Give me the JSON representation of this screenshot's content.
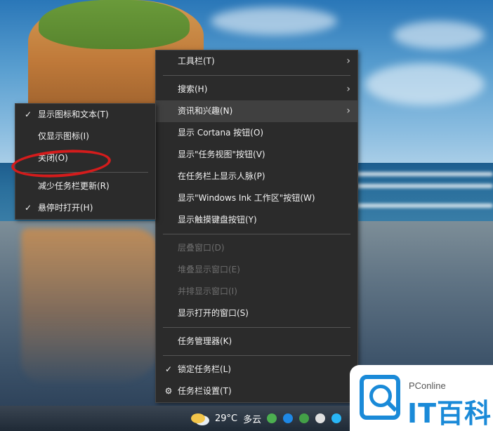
{
  "main_menu": {
    "items": [
      {
        "label": "工具栏(T)",
        "has_submenu": true
      },
      {
        "label": "搜索(H)",
        "has_submenu": true
      },
      {
        "label": "资讯和兴趣(N)",
        "has_submenu": true
      },
      {
        "label": "显示 Cortana 按钮(O)"
      },
      {
        "label": "显示\"任务视图\"按钮(V)"
      },
      {
        "label": "在任务栏上显示人脉(P)"
      },
      {
        "label": "显示\"Windows Ink 工作区\"按钮(W)"
      },
      {
        "label": "显示触摸键盘按钮(Y)"
      },
      {
        "label": "层叠窗口(D)",
        "disabled": true
      },
      {
        "label": "堆叠显示窗口(E)",
        "disabled": true
      },
      {
        "label": "并排显示窗口(I)",
        "disabled": true
      },
      {
        "label": "显示打开的窗口(S)"
      },
      {
        "label": "任务管理器(K)"
      },
      {
        "label": "锁定任务栏(L)",
        "checked": true
      },
      {
        "label": "任务栏设置(T)"
      }
    ]
  },
  "sub_menu": {
    "items": [
      {
        "label": "显示图标和文本(T)",
        "checked": true
      },
      {
        "label": "仅显示图标(I)"
      },
      {
        "label": "关闭(O)"
      },
      {
        "label": "减少任务栏更新(R)"
      },
      {
        "label": "悬停时打开(H)",
        "checked": true
      }
    ]
  },
  "glyphs": {
    "check": "✓",
    "chevron": "›",
    "gear": "⚙"
  },
  "taskbar": {
    "temperature": "29°C",
    "weather": "多云"
  },
  "watermark": {
    "brand": "PConline",
    "title": "IT百科"
  },
  "colors": {
    "menu_bg": "#2b2b2b",
    "menu_hover": "#404040",
    "annotation": "#d41c1c",
    "watermark_blue": "#1a8ad8"
  }
}
